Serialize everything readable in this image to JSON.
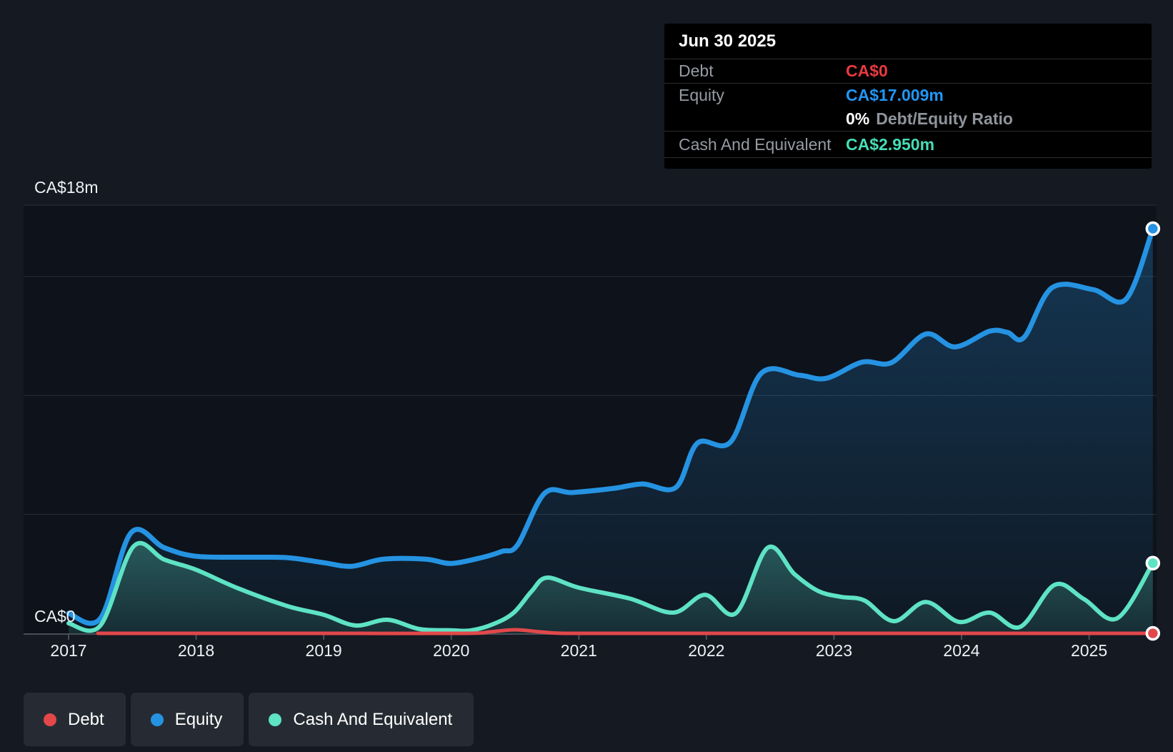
{
  "y_axis": {
    "top_label": "CA$18m",
    "bottom_label": "CA$0"
  },
  "x_axis": {
    "years": [
      "2017",
      "2018",
      "2019",
      "2020",
      "2021",
      "2022",
      "2023",
      "2024",
      "2025"
    ]
  },
  "tooltip": {
    "date": "Jun 30 2025",
    "rows": [
      {
        "key": "debt",
        "label": "Debt",
        "value": "CA$0",
        "value_color": "#e8393e"
      },
      {
        "key": "equity",
        "label": "Equity",
        "value": "CA$17.009m",
        "value_color": "#2196f3"
      },
      {
        "key": "cash",
        "label": "Cash And Equivalent",
        "value": "CA$2.950m",
        "value_color": "#45ddb7"
      }
    ],
    "ratio": {
      "value": "0%",
      "label": "Debt/Equity Ratio"
    }
  },
  "legend": {
    "items": [
      {
        "label": "Debt",
        "color": "#e2484a"
      },
      {
        "label": "Equity",
        "color": "#2593e2"
      },
      {
        "label": "Cash And Equivalent",
        "color": "#5ee3c4"
      }
    ]
  },
  "chart_data": {
    "type": "area",
    "unit": "CA$ millions",
    "x_range": [
      2017.0,
      2025.5
    ],
    "ylim": [
      0,
      18
    ],
    "y_gridlines": [
      18,
      15,
      10,
      5,
      0
    ],
    "x_ticks": [
      2017,
      2018,
      2019,
      2020,
      2021,
      2022,
      2023,
      2024,
      2025
    ],
    "legend_position": "bottom-left",
    "series": [
      {
        "name": "Equity",
        "color": "#2593e2",
        "points": [
          [
            2017.0,
            0.84
          ],
          [
            2017.25,
            0.63
          ],
          [
            2017.49,
            4.23
          ],
          [
            2017.75,
            3.6
          ],
          [
            2018.0,
            3.24
          ],
          [
            2018.4,
            3.2
          ],
          [
            2018.72,
            3.18
          ],
          [
            2019.0,
            2.97
          ],
          [
            2019.22,
            2.82
          ],
          [
            2019.47,
            3.12
          ],
          [
            2019.8,
            3.12
          ],
          [
            2020.0,
            2.94
          ],
          [
            2020.25,
            3.2
          ],
          [
            2020.4,
            3.45
          ],
          [
            2020.52,
            3.72
          ],
          [
            2020.73,
            5.88
          ],
          [
            2020.95,
            5.92
          ],
          [
            2021.28,
            6.1
          ],
          [
            2021.5,
            6.28
          ],
          [
            2021.76,
            6.13
          ],
          [
            2021.93,
            8.0
          ],
          [
            2022.19,
            8.05
          ],
          [
            2022.43,
            10.93
          ],
          [
            2022.73,
            10.85
          ],
          [
            2022.94,
            10.72
          ],
          [
            2023.22,
            11.4
          ],
          [
            2023.45,
            11.38
          ],
          [
            2023.72,
            12.58
          ],
          [
            2023.95,
            12.04
          ],
          [
            2024.22,
            12.7
          ],
          [
            2024.36,
            12.65
          ],
          [
            2024.49,
            12.44
          ],
          [
            2024.71,
            14.53
          ],
          [
            2025.03,
            14.45
          ],
          [
            2025.29,
            14.05
          ],
          [
            2025.5,
            17.009
          ]
        ],
        "end_value_label": "CA$17.009m"
      },
      {
        "name": "Cash And Equivalent",
        "color": "#5ee3c4",
        "points": [
          [
            2017.0,
            0.42
          ],
          [
            2017.25,
            0.33
          ],
          [
            2017.51,
            3.66
          ],
          [
            2017.75,
            3.1
          ],
          [
            2018.0,
            2.67
          ],
          [
            2018.33,
            1.89
          ],
          [
            2018.72,
            1.14
          ],
          [
            2019.0,
            0.78
          ],
          [
            2019.25,
            0.33
          ],
          [
            2019.5,
            0.57
          ],
          [
            2019.75,
            0.18
          ],
          [
            2020.0,
            0.13
          ],
          [
            2020.15,
            0.12
          ],
          [
            2020.33,
            0.39
          ],
          [
            2020.49,
            0.87
          ],
          [
            2020.63,
            1.77
          ],
          [
            2020.75,
            2.34
          ],
          [
            2021.0,
            1.92
          ],
          [
            2021.4,
            1.46
          ],
          [
            2021.74,
            0.87
          ],
          [
            2021.99,
            1.62
          ],
          [
            2022.23,
            0.84
          ],
          [
            2022.48,
            3.6
          ],
          [
            2022.69,
            2.49
          ],
          [
            2022.88,
            1.77
          ],
          [
            2023.06,
            1.53
          ],
          [
            2023.24,
            1.38
          ],
          [
            2023.47,
            0.51
          ],
          [
            2023.72,
            1.32
          ],
          [
            2023.98,
            0.48
          ],
          [
            2024.22,
            0.87
          ],
          [
            2024.46,
            0.27
          ],
          [
            2024.73,
            2.04
          ],
          [
            2024.96,
            1.44
          ],
          [
            2025.22,
            0.63
          ],
          [
            2025.5,
            2.95
          ]
        ],
        "end_value_label": "CA$2.950m"
      },
      {
        "name": "Debt",
        "color": "#e2484a",
        "points": [
          [
            2017.23,
            0
          ],
          [
            2018.0,
            0
          ],
          [
            2019.0,
            0
          ],
          [
            2020.1,
            0
          ],
          [
            2020.3,
            0.06
          ],
          [
            2020.5,
            0.15
          ],
          [
            2020.7,
            0.06
          ],
          [
            2020.9,
            0
          ],
          [
            2021.5,
            0
          ],
          [
            2022.5,
            0
          ],
          [
            2023.5,
            0
          ],
          [
            2024.5,
            0
          ],
          [
            2025.5,
            0
          ]
        ],
        "end_value_label": "CA$0"
      }
    ]
  }
}
